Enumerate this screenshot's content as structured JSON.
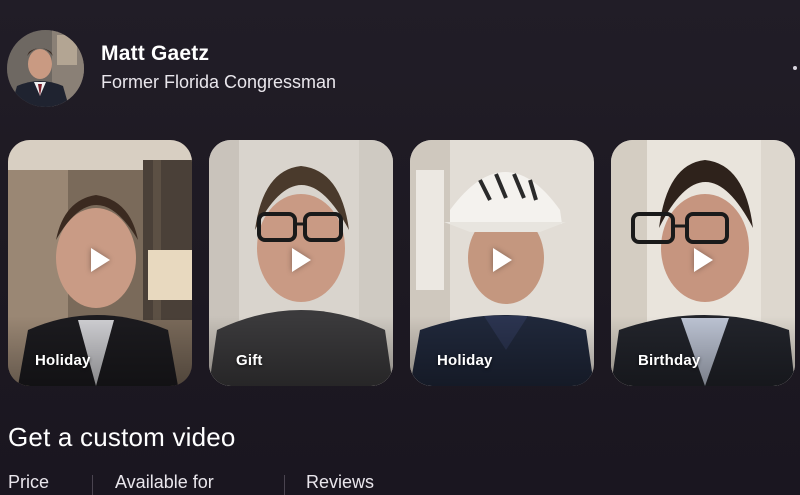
{
  "profile": {
    "name": "Matt Gaetz",
    "subtitle": "Former Florida Congressman"
  },
  "videos": [
    {
      "label": "Holiday"
    },
    {
      "label": "Gift"
    },
    {
      "label": "Holiday"
    },
    {
      "label": "Birthday"
    }
  ],
  "section": {
    "title": "Get a custom video"
  },
  "stats": {
    "price_label": "Price",
    "available_label": "Available for",
    "reviews_label": "Reviews"
  },
  "colors": {
    "background": "#1e1a23",
    "text": "#ffffff",
    "muted_text": "#e9e6ec"
  },
  "icons": {
    "play": "play-icon",
    "more": "more-dot-icon"
  }
}
